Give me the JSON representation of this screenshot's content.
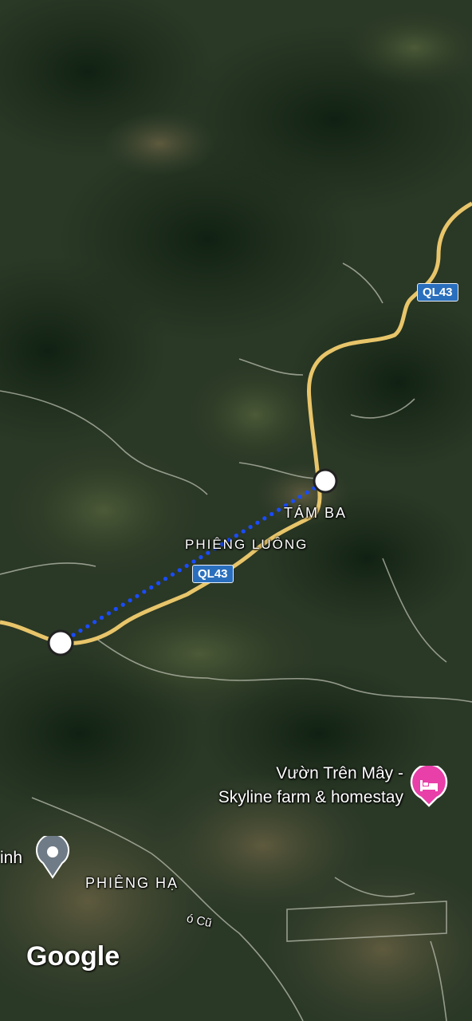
{
  "map": {
    "view": "satellite",
    "route_color": "#1a4cff",
    "road_color": "#e8c56a"
  },
  "labels": {
    "place_tam_ba": "TÁM BA",
    "place_phieng_luong": "PHIÊNG LUÔNG",
    "place_phieng_ha": "PHIÊNG HẠ",
    "road_co_cu": "ó Cũ",
    "partial_inh": "inh"
  },
  "shields": {
    "ql43_top": "QL43",
    "ql43_mid": "QL43"
  },
  "poi": {
    "name_line1": "Vườn Trên Mây -",
    "name_line2": "Skyline farm & homestay",
    "icon": "hotel-bed-icon",
    "color": "#e83fa8"
  },
  "location_pin": {
    "icon": "location-pin-icon"
  },
  "attribution": {
    "logo_text": "Google"
  }
}
